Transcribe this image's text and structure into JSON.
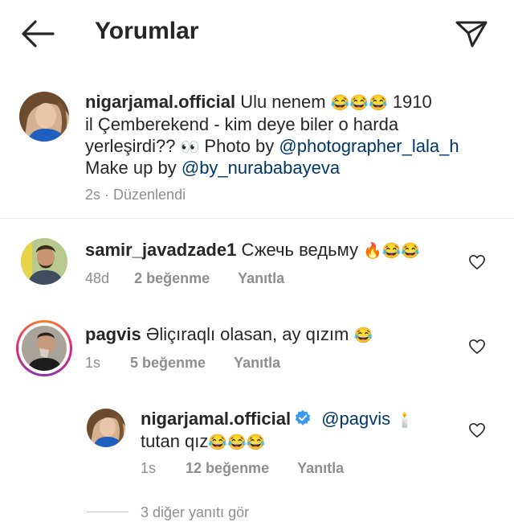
{
  "header": {
    "title": "Yorumlar"
  },
  "caption": {
    "username": "nigarjamal.official",
    "text_1": "Ulu nenem",
    "emoji_1": "😂😂😂",
    "year": "1910",
    "text_2": "il Çemberekend - kim deye biler o harda",
    "text_3": "yerleşirdi??",
    "emoji_2": "👀",
    "photo_by": "Photo by",
    "photographer": "@photographer_lala_h",
    "makeup_by": "Make up by",
    "makeup_artist": "@by_nurababayeva",
    "time": "2s",
    "edited": "Düzenlendi"
  },
  "comments": [
    {
      "username": "samir_javadzade1",
      "text": "Сжечь ведьму",
      "emoji": "🔥😂😂",
      "time": "48d",
      "likes": "2 beğenme",
      "reply": "Yanıtla"
    },
    {
      "username": "pagvis",
      "text": "Əliçıraqlı olasan, ay qızım",
      "emoji": "😂",
      "time": "1s",
      "likes": "5 beğenme",
      "reply": "Yanıtla"
    }
  ],
  "reply": {
    "username": "nigarjamal.official",
    "mention": "@pagvis",
    "emoji_1": "🕯️",
    "text": "tutan qız",
    "emoji_2": "😂😂😂",
    "time": "1s",
    "likes": "12 beğenme",
    "reply": "Yanıtla"
  },
  "view_replies": "3 diğer yanıtı gör",
  "colors": {
    "mention": "#00376b",
    "verified": "#3897f0",
    "meta": "#8e8e8e"
  },
  "icons": [
    "back-arrow-icon",
    "send-icon",
    "heart-icon",
    "verified-badge-icon"
  ]
}
